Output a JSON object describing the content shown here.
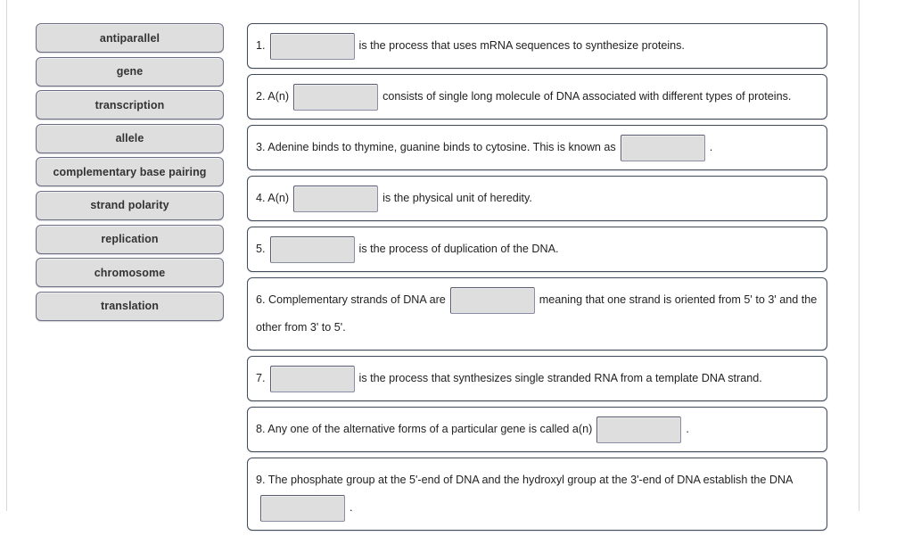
{
  "exercise": {
    "type": "drag-and-drop-fill-in-the-blank",
    "topic": "DNA and genetics vocabulary"
  },
  "word_bank": {
    "items": [
      {
        "label": "antiparallel"
      },
      {
        "label": "gene"
      },
      {
        "label": "transcription"
      },
      {
        "label": "allele"
      },
      {
        "label": "complementary base pairing"
      },
      {
        "label": "strand polarity"
      },
      {
        "label": "replication"
      },
      {
        "label": "chromosome"
      },
      {
        "label": "translation"
      }
    ]
  },
  "questions": [
    {
      "number": "1.",
      "segments": [
        {
          "kind": "text",
          "value": "1."
        },
        {
          "kind": "blank"
        },
        {
          "kind": "text",
          "value": "is the process that uses mRNA sequences to synthesize proteins."
        }
      ]
    },
    {
      "number": "2.",
      "segments": [
        {
          "kind": "text",
          "value": "2. A(n)"
        },
        {
          "kind": "blank"
        },
        {
          "kind": "text",
          "value": "consists of single long molecule of DNA associated with different types of proteins."
        }
      ]
    },
    {
      "number": "3.",
      "segments": [
        {
          "kind": "text",
          "value": "3. Adenine binds to thymine, guanine binds to cytosine. This is known as"
        },
        {
          "kind": "blank"
        },
        {
          "kind": "text",
          "value": "."
        }
      ]
    },
    {
      "number": "4.",
      "segments": [
        {
          "kind": "text",
          "value": "4. A(n)"
        },
        {
          "kind": "blank"
        },
        {
          "kind": "text",
          "value": "is the physical unit of heredity."
        }
      ]
    },
    {
      "number": "5.",
      "segments": [
        {
          "kind": "text",
          "value": "5."
        },
        {
          "kind": "blank"
        },
        {
          "kind": "text",
          "value": "is the process of duplication of the DNA."
        }
      ]
    },
    {
      "number": "6.",
      "segments": [
        {
          "kind": "text",
          "value": "6. Complementary strands of DNA are"
        },
        {
          "kind": "blank"
        },
        {
          "kind": "text",
          "value": "meaning that one strand is oriented from 5' to 3' and the other from 3' to 5'."
        }
      ]
    },
    {
      "number": "7.",
      "segments": [
        {
          "kind": "text",
          "value": "7."
        },
        {
          "kind": "blank"
        },
        {
          "kind": "text",
          "value": "is the process that synthesizes single stranded RNA from a template DNA strand."
        }
      ]
    },
    {
      "number": "8.",
      "segments": [
        {
          "kind": "text",
          "value": "8. Any one of the alternative forms of a particular gene is called a(n)"
        },
        {
          "kind": "blank"
        },
        {
          "kind": "text",
          "value": "."
        }
      ]
    },
    {
      "number": "9.",
      "segments": [
        {
          "kind": "text",
          "value": "9. The phosphate group at the 5'-end of DNA and the hydroxyl group at the 3'-end of DNA establish the DNA"
        },
        {
          "kind": "blank"
        },
        {
          "kind": "text",
          "value": "."
        }
      ]
    }
  ],
  "colors": {
    "chip_fill": "#dedede",
    "chip_border": "#6b6e85",
    "panel_border": "#3f4a5a",
    "blank_fill": "#dedede",
    "page_background": "#ffffff",
    "text": "#222222"
  }
}
